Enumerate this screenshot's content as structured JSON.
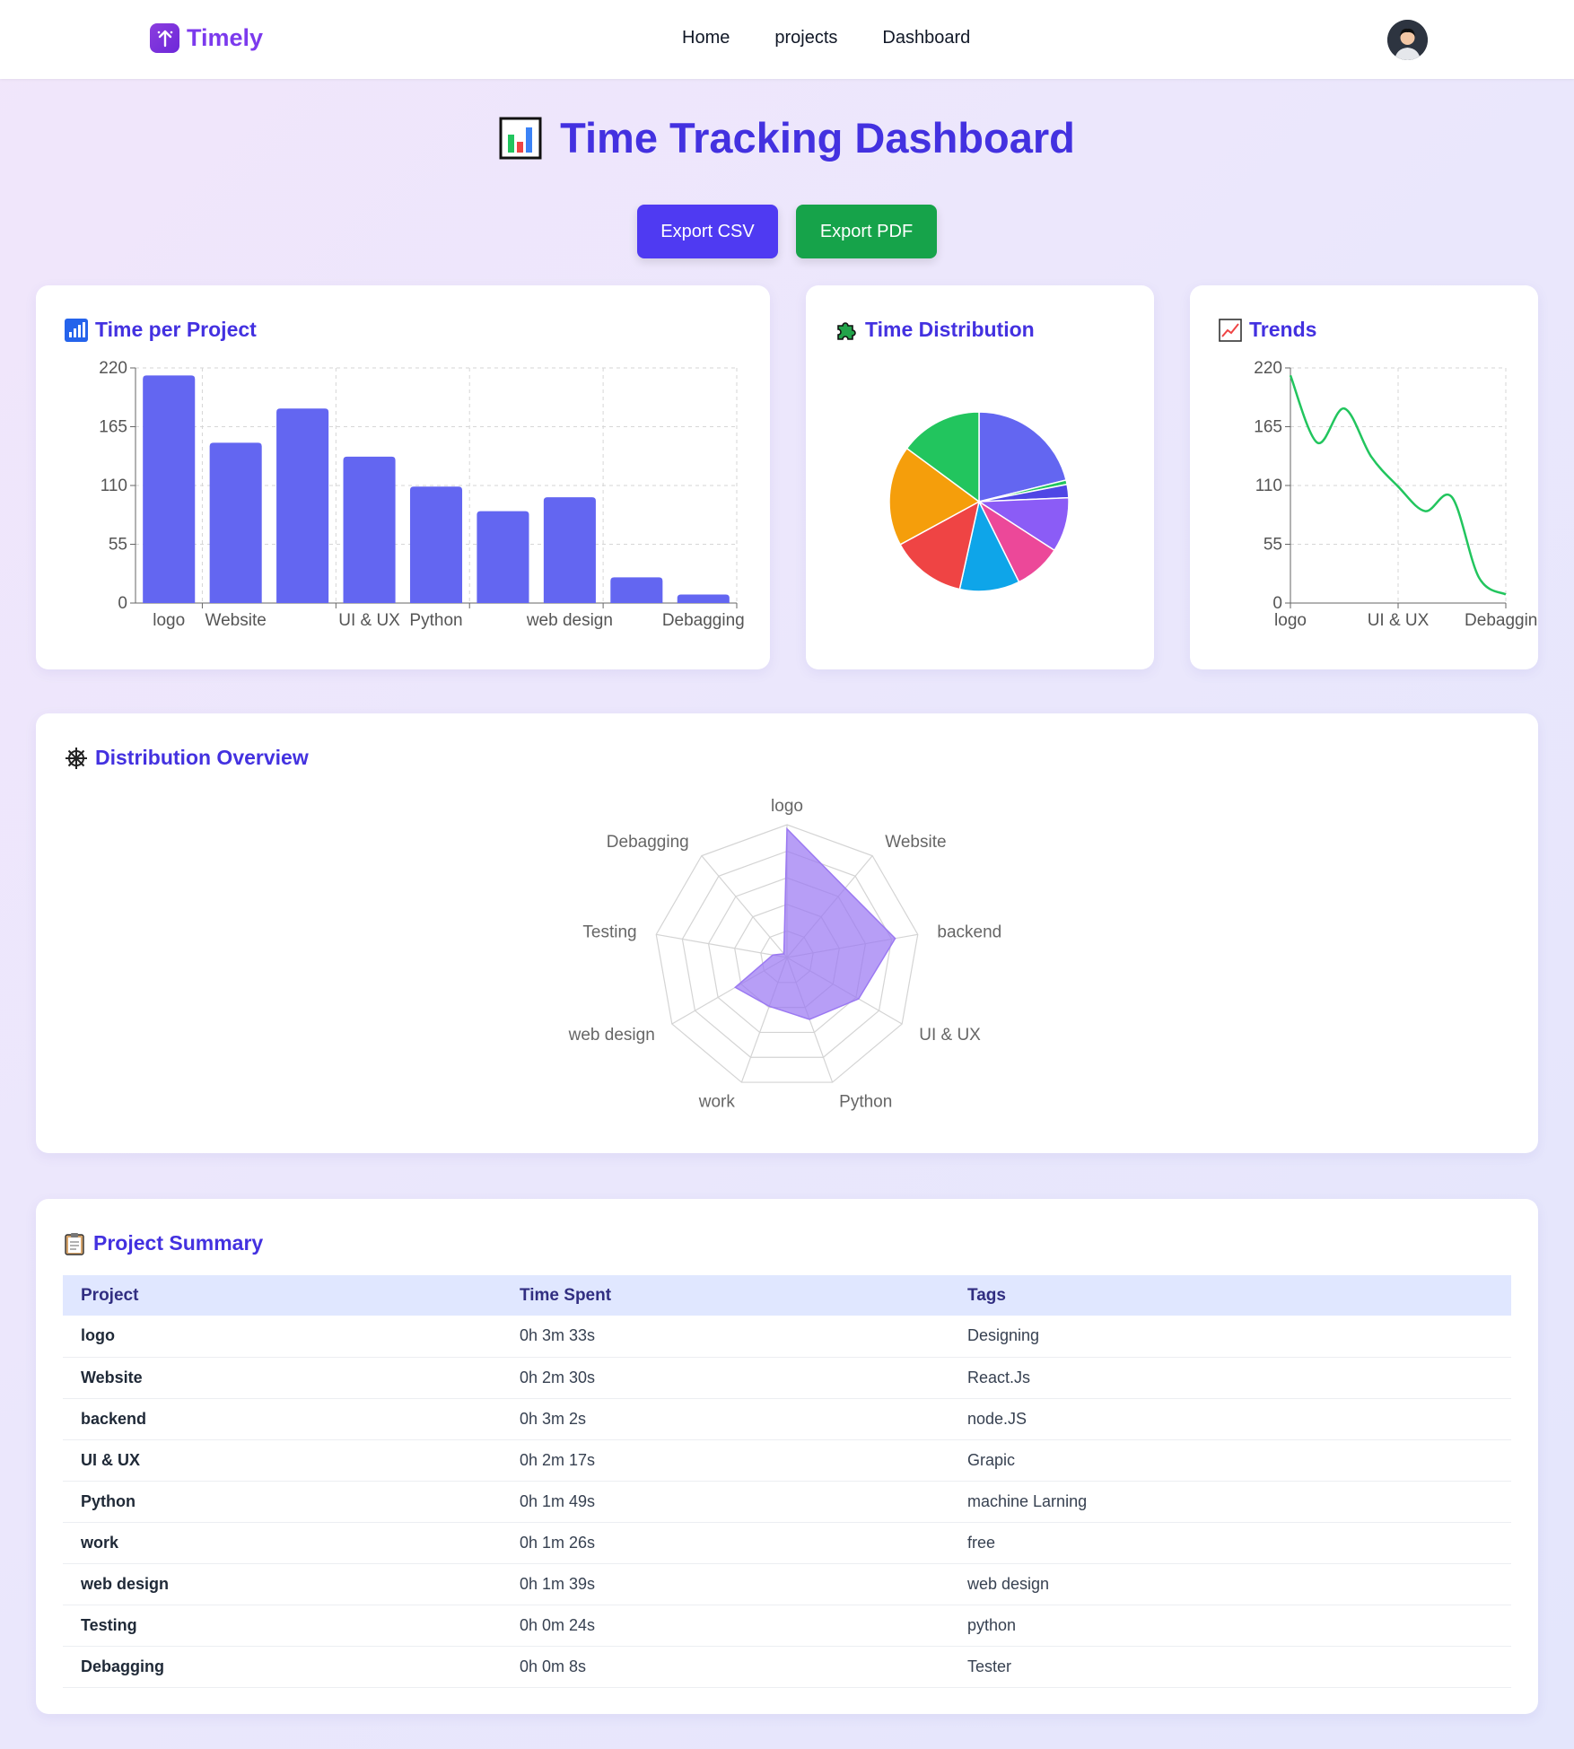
{
  "nav": {
    "brand": "Timely",
    "links": [
      "Home",
      "projects",
      "Dashboard"
    ]
  },
  "page": {
    "title": "Time Tracking Dashboard",
    "export_csv": "Export CSV",
    "export_pdf": "Export PDF"
  },
  "cards": {
    "time_per_project": "Time per Project",
    "time_distribution": "Time Distribution",
    "trends": "Trends",
    "distribution_overview": "Distribution Overview",
    "project_summary": "Project Summary"
  },
  "colors": {
    "accent": "#4331e0",
    "bar": "#6366f1",
    "line": "#22c55e",
    "radar": "#9b79f2",
    "csv_button": "#4f3af2",
    "pdf_button": "#16a34a"
  },
  "chart_data": [
    {
      "type": "bar",
      "title": "Time per Project",
      "categories": [
        "logo",
        "Website",
        "backend",
        "UI & UX",
        "Python",
        "work",
        "web design",
        "Testing",
        "Debagging"
      ],
      "shown_tick_labels": [
        "logo",
        "Website",
        "",
        "UI & UX",
        "Python",
        "",
        "web design",
        "",
        "Debagging"
      ],
      "values": [
        213,
        150,
        182,
        137,
        109,
        86,
        99,
        24,
        8
      ],
      "ylim": [
        0,
        220
      ],
      "yticks": [
        0,
        55,
        110,
        165,
        220
      ],
      "grid": true
    },
    {
      "type": "pie",
      "title": "Time Distribution",
      "labels": [
        "logo",
        "Website",
        "backend",
        "UI & UX",
        "Python",
        "work",
        "web design",
        "Testing",
        "Debagging"
      ],
      "values": [
        213,
        150,
        182,
        137,
        109,
        86,
        99,
        24,
        8
      ],
      "colors": [
        "#6366f1",
        "#22c55e",
        "#f59e0b",
        "#ef4444",
        "#0ea5e9",
        "#ec4899",
        "#8b5cf6",
        "#4f46e5",
        "#22c55e"
      ],
      "display_order": [
        0,
        8,
        7,
        6,
        5,
        4,
        3,
        2,
        1
      ]
    },
    {
      "type": "line",
      "title": "Trends",
      "categories": [
        "logo",
        "Website",
        "backend",
        "UI & UX",
        "Python",
        "work",
        "web design",
        "Testing",
        "Debagging"
      ],
      "shown_tick_labels": [
        "logo",
        "",
        "",
        "UI & UX",
        "",
        "",
        "Debagging"
      ],
      "values": [
        213,
        150,
        182,
        137,
        109,
        86,
        99,
        24,
        8
      ],
      "ylim": [
        0,
        220
      ],
      "yticks": [
        0,
        55,
        110,
        165,
        220
      ],
      "grid": true
    },
    {
      "type": "radar",
      "title": "Distribution Overview",
      "labels": [
        "logo",
        "Website",
        "backend",
        "UI & UX",
        "Python",
        "work",
        "web design",
        "Testing",
        "Debagging"
      ],
      "values": [
        213,
        150,
        182,
        137,
        109,
        86,
        99,
        24,
        8
      ],
      "max": 220
    }
  ],
  "table": {
    "headers": [
      "Project",
      "Time Spent",
      "Tags"
    ],
    "rows": [
      [
        "logo",
        "0h 3m 33s",
        "Designing"
      ],
      [
        "Website",
        "0h 2m 30s",
        "React.Js"
      ],
      [
        "backend",
        "0h 3m 2s",
        "node.JS"
      ],
      [
        "UI & UX",
        "0h 2m 17s",
        "Grapic"
      ],
      [
        "Python",
        "0h 1m 49s",
        "machine Larning"
      ],
      [
        "work",
        "0h 1m 26s",
        "free"
      ],
      [
        "web design",
        "0h 1m 39s",
        "web design"
      ],
      [
        "Testing",
        "0h 0m 24s",
        "python"
      ],
      [
        "Debagging",
        "0h 0m 8s",
        "Tester"
      ]
    ]
  }
}
